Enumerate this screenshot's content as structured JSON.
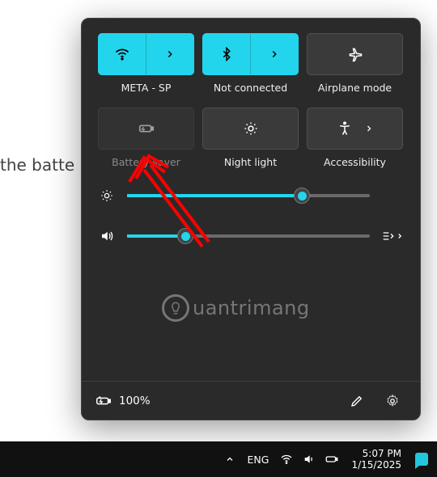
{
  "background_text": "the batte",
  "tiles": {
    "wifi_label": "META - SP",
    "bluetooth_label": "Not connected",
    "airplane_label": "Airplane mode",
    "battery_saver_label": "Battery saver",
    "night_light_label": "Night light",
    "accessibility_label": "Accessibility"
  },
  "sliders": {
    "brightness_pct": 72,
    "volume_pct": 24
  },
  "battery_pct_label": "100%",
  "taskbar": {
    "lang": "ENG",
    "time": "5:07 PM",
    "date": "1/15/2025"
  },
  "watermark_text": "uantrimang"
}
